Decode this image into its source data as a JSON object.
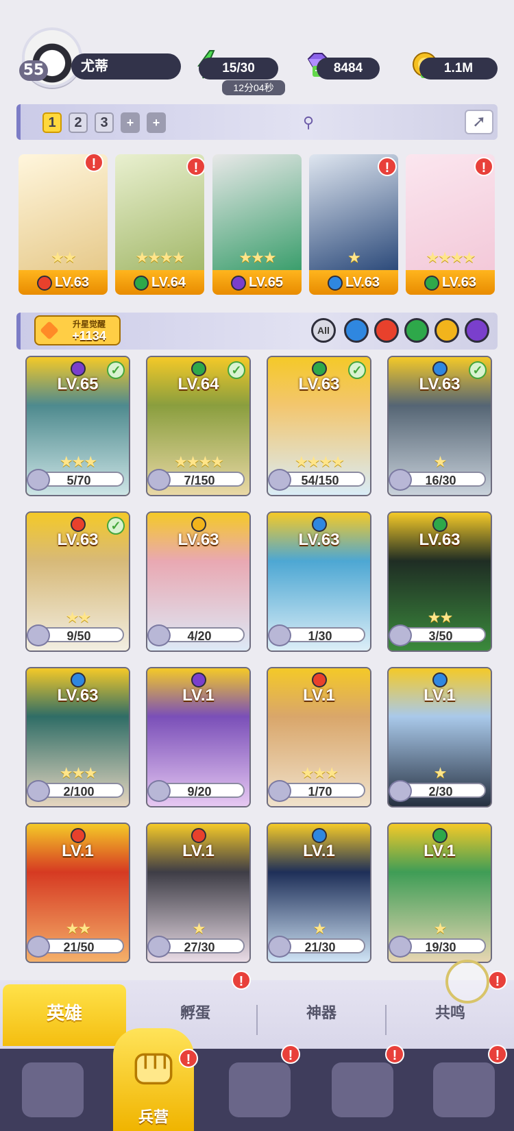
{
  "profile": {
    "level": "55",
    "name": "尤蒂"
  },
  "resources": {
    "energy": "15/30",
    "energy_timer": "12分04秒",
    "gems": "8484",
    "gold": "1.1M"
  },
  "team": {
    "tabs": [
      "1",
      "2",
      "3",
      "+",
      "+"
    ],
    "active_tab": "1",
    "members": [
      {
        "level": "LV.63",
        "element": "fire",
        "stars": "★★",
        "alert": "!"
      },
      {
        "level": "LV.64",
        "element": "nature",
        "stars": "★★★★",
        "alert": "!"
      },
      {
        "level": "LV.65",
        "element": "dark",
        "stars": "★★★",
        "alert": ""
      },
      {
        "level": "LV.63",
        "element": "water",
        "stars": "★",
        "alert": "!"
      },
      {
        "level": "LV.63",
        "element": "nature",
        "stars": "★★★★",
        "alert": "!"
      }
    ]
  },
  "awaken": {
    "title": "升星觉醒",
    "value": "+1134"
  },
  "filters": {
    "all": "All",
    "elements": [
      "water",
      "fire",
      "nature",
      "light",
      "dark"
    ]
  },
  "colors": {
    "fire": "#e8412c",
    "water": "#2f87e0",
    "nature": "#2ea84a",
    "light": "#f2b41c",
    "dark": "#7a3fcc",
    "accent": "#ffd83c"
  },
  "heroes": [
    {
      "level": "LV.65",
      "element": "dark",
      "stars": "★★★",
      "progress": "5/70",
      "check": true,
      "art": [
        "#4e8a8e",
        "#cde5e6"
      ]
    },
    {
      "level": "LV.64",
      "element": "nature",
      "stars": "★★★★",
      "progress": "7/150",
      "check": true,
      "art": [
        "#8a9e3e",
        "#e9d8a6"
      ]
    },
    {
      "level": "LV.63",
      "element": "nature",
      "stars": "★★★★",
      "progress": "54/150",
      "check": true,
      "art": [
        "#f3c66e",
        "#d9ecf7"
      ]
    },
    {
      "level": "LV.63",
      "element": "water",
      "stars": "★",
      "progress": "16/30",
      "check": true,
      "art": [
        "#556574",
        "#c9d2db"
      ]
    },
    {
      "level": "LV.63",
      "element": "fire",
      "stars": "★★",
      "progress": "9/50",
      "check": true,
      "art": [
        "#d7b978",
        "#f2eee2"
      ]
    },
    {
      "level": "LV.63",
      "element": "light",
      "stars": "",
      "progress": "4/20",
      "check": false,
      "art": [
        "#e9a8b2",
        "#dde9f6"
      ]
    },
    {
      "level": "LV.63",
      "element": "water",
      "stars": "",
      "progress": "1/30",
      "check": false,
      "art": [
        "#4da7d3",
        "#dceef7"
      ]
    },
    {
      "level": "LV.63",
      "element": "nature",
      "stars": "★★",
      "progress": "3/50",
      "check": false,
      "art": [
        "#1f2d24",
        "#3b8a3c"
      ]
    },
    {
      "level": "LV.63",
      "element": "water",
      "stars": "★★★",
      "progress": "2/100",
      "check": false,
      "art": [
        "#2f6d66",
        "#e6d6c0"
      ]
    },
    {
      "level": "LV.1",
      "element": "dark",
      "stars": "",
      "progress": "9/20",
      "check": false,
      "art": [
        "#7a4fb8",
        "#e6c8f2"
      ]
    },
    {
      "level": "LV.1",
      "element": "fire",
      "stars": "★★★",
      "progress": "1/70",
      "check": false,
      "art": [
        "#d9a66a",
        "#f0e2cc"
      ]
    },
    {
      "level": "LV.1",
      "element": "water",
      "stars": "★",
      "progress": "2/30",
      "check": false,
      "art": [
        "#a9c9ea",
        "#263040"
      ]
    },
    {
      "level": "LV.1",
      "element": "fire",
      "stars": "★★",
      "progress": "21/50",
      "check": false,
      "art": [
        "#d63a22",
        "#f4b06a"
      ]
    },
    {
      "level": "LV.1",
      "element": "fire",
      "stars": "★",
      "progress": "27/30",
      "check": false,
      "art": [
        "#3e3d46",
        "#e9dce6"
      ]
    },
    {
      "level": "LV.1",
      "element": "water",
      "stars": "★",
      "progress": "21/30",
      "check": false,
      "art": [
        "#1e2f58",
        "#cfe3f5"
      ]
    },
    {
      "level": "LV.1",
      "element": "nature",
      "stars": "★",
      "progress": "19/30",
      "check": false,
      "art": [
        "#3f9d56",
        "#e7d6b2"
      ]
    }
  ],
  "tabs": {
    "heroes": "英雄",
    "hatch": "孵蛋",
    "artifact": "神器",
    "resonance": "共鸣"
  },
  "nav": {
    "barracks": "兵营"
  }
}
